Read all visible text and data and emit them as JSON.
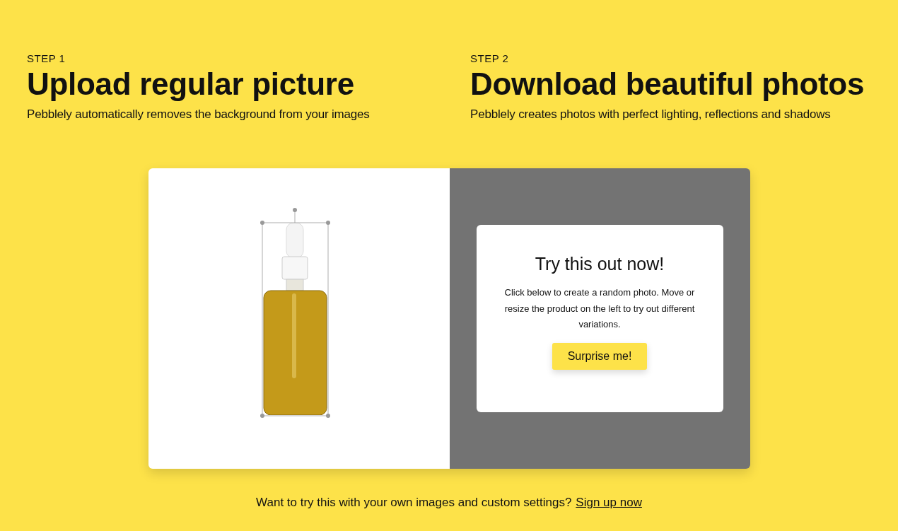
{
  "steps": [
    {
      "label": "STEP 1",
      "title": "Upload regular picture",
      "description": "Pebblely automatically removes the background from your images"
    },
    {
      "label": "STEP 2",
      "title": "Download beautiful photos",
      "description": "Pebblely creates photos with perfect lighting, reflections and shadows"
    }
  ],
  "demo": {
    "prompt": {
      "title": "Try this out now!",
      "text": "Click below to create a random photo. Move or resize the product on the left to try out different variations.",
      "button": "Surprise me!"
    }
  },
  "footer": {
    "text": "Want to try this with your own images and custom settings?",
    "link": "Sign up now"
  }
}
